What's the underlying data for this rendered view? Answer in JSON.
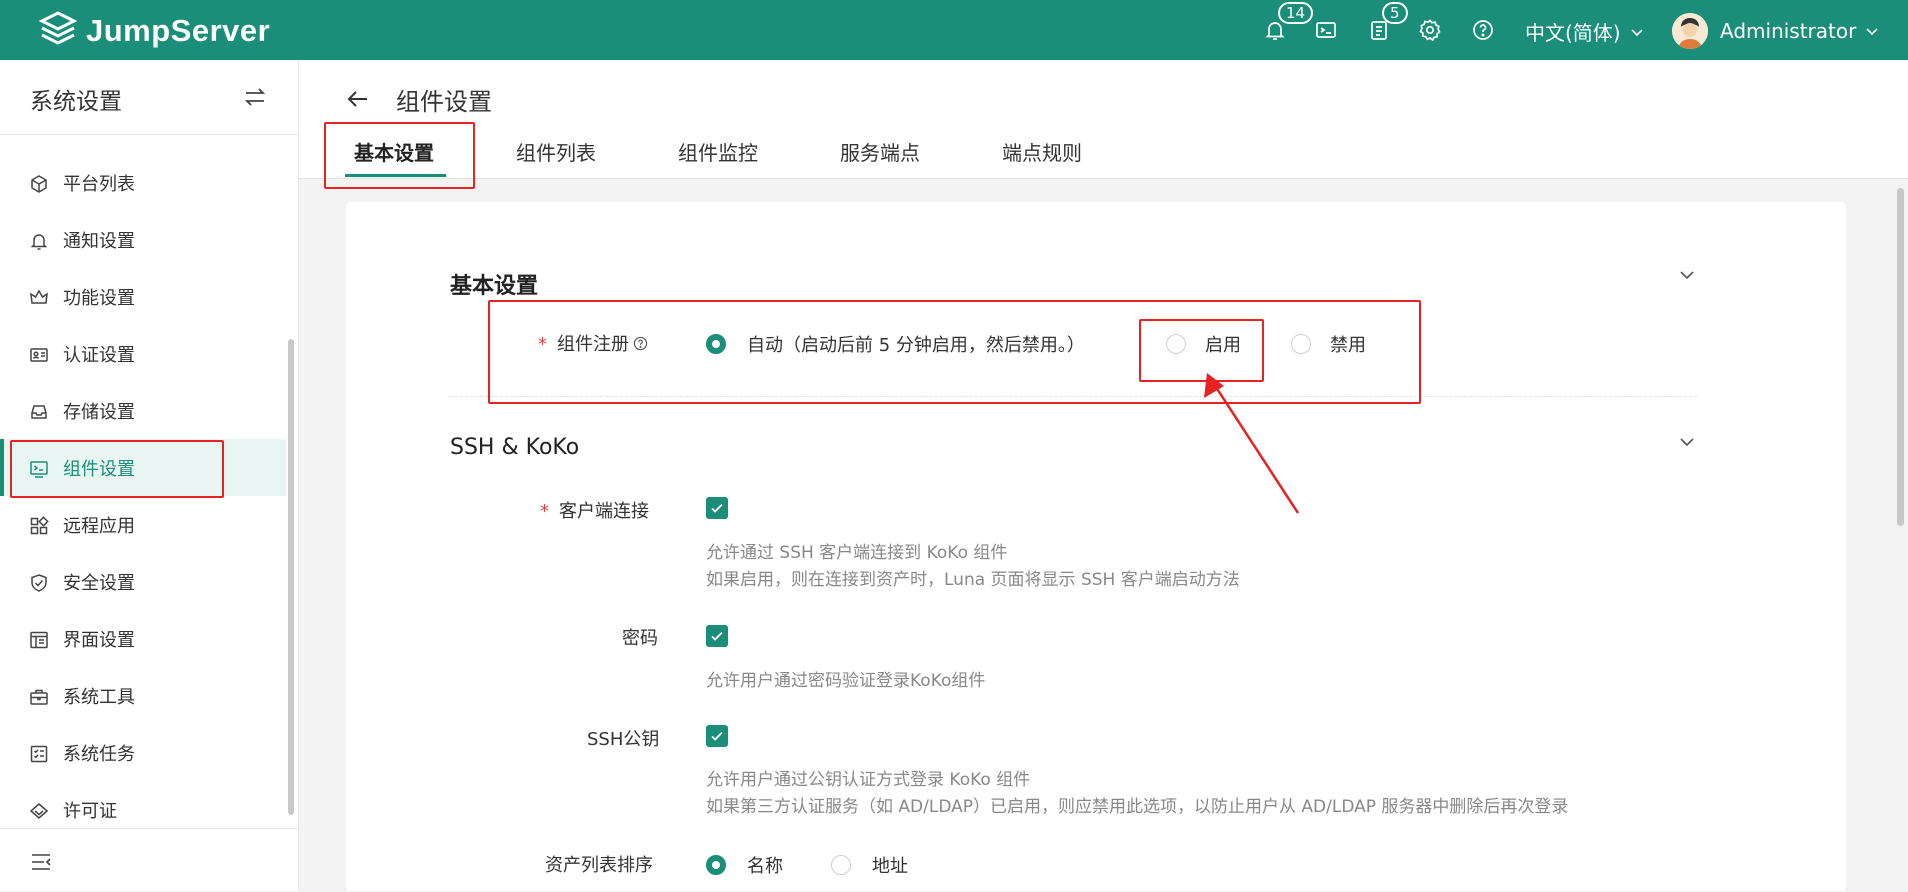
{
  "header": {
    "brand": "JumpServer",
    "notifications_count": "14",
    "tickets_count": "5",
    "language": "中文(简体)",
    "user_name": "Administrator"
  },
  "sidebar": {
    "title": "系统设置",
    "items": [
      {
        "label": "平台列表",
        "icon": "cube-icon"
      },
      {
        "label": "通知设置",
        "icon": "bell-icon"
      },
      {
        "label": "功能设置",
        "icon": "crown-icon"
      },
      {
        "label": "认证设置",
        "icon": "id-card-icon"
      },
      {
        "label": "存储设置",
        "icon": "inbox-icon"
      },
      {
        "label": "组件设置",
        "icon": "terminal-icon",
        "active": true
      },
      {
        "label": "远程应用",
        "icon": "apps-icon"
      },
      {
        "label": "安全设置",
        "icon": "shield-icon"
      },
      {
        "label": "界面设置",
        "icon": "layout-icon"
      },
      {
        "label": "系统工具",
        "icon": "toolbox-icon"
      },
      {
        "label": "系统任务",
        "icon": "task-list-icon"
      },
      {
        "label": "许可证",
        "icon": "license-icon"
      }
    ]
  },
  "page": {
    "title": "组件设置",
    "tabs": [
      "基本设置",
      "组件列表",
      "组件监控",
      "服务端点",
      "端点规则"
    ],
    "active_tab": "基本设置"
  },
  "basic": {
    "section_title": "基本设置",
    "register_label": "组件注册",
    "register_options": [
      "自动（启动后前 5 分钟启用，然后禁用。）",
      "启用",
      "禁用"
    ],
    "register_selected": "自动（启动后前 5 分钟启用，然后禁用。）"
  },
  "ssh": {
    "section_title": "SSH & KoKo",
    "client_label": "客户端连接",
    "client_checked": true,
    "client_help1": "允许通过 SSH 客户端连接到 KoKo 组件",
    "client_help2": "如果启用，则在连接到资产时，Luna 页面将显示 SSH 客户端启动方法",
    "password_label": "密码",
    "password_checked": true,
    "password_help": "允许用户通过密码验证登录KoKo组件",
    "pubkey_label": "SSH公钥",
    "pubkey_checked": true,
    "pubkey_help1": "允许用户通过公钥认证方式登录 KoKo 组件",
    "pubkey_help2": "如果第三方认证服务（如 AD/LDAP）已启用，则应禁用此选项，以防止用户从 AD/LDAP 服务器中删除后再次登录",
    "sort_label": "资产列表排序",
    "sort_options": [
      "名称",
      "地址"
    ],
    "sort_selected": "名称"
  },
  "colors": {
    "brand": "#1a8e78",
    "annotation": "#e62222"
  }
}
